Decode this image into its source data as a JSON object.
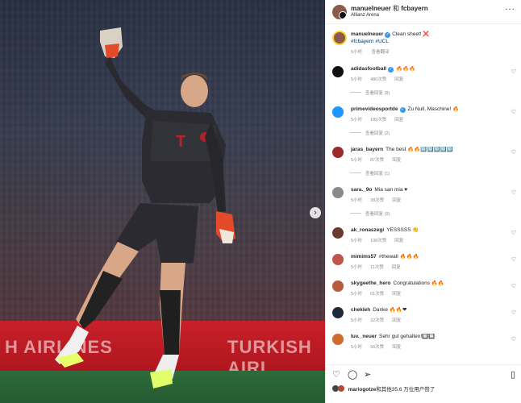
{
  "header": {
    "account": "manuelneuer",
    "joiner": "和",
    "collab": "fcbayern",
    "location": "Allianz Arena",
    "more": "···"
  },
  "caption": {
    "user": "manuelneuer",
    "text": "Clean sheet! ❌",
    "tags": "#fcbayern #UCL",
    "time": "5小时",
    "translate": "查看翻译"
  },
  "photo": {
    "ad_text_left": "H AIRLINES",
    "ad_text_right": "TURKISH AIRL",
    "next": "›"
  },
  "comments": [
    {
      "user": "adidasfootball",
      "verified": true,
      "text": "🔥🔥🔥",
      "time": "5小时",
      "likes": "480次赞",
      "reply": "回复",
      "replies": "查看回复 (8)",
      "avatar": "#111111"
    },
    {
      "user": "primevideosportde",
      "verified": true,
      "text": "Zu Null, Maschine! 🔥",
      "time": "5小时",
      "likes": "189次赞",
      "reply": "回复",
      "replies": "查看回复 (2)",
      "avatar": "#1a98ff"
    },
    {
      "user": "jaras_bayern",
      "verified": false,
      "text": "The best 🔥🔥🔟🔟🔟🔟🔟",
      "time": "5小时",
      "likes": "87次赞",
      "reply": "回复",
      "replies": "查看回复 (1)",
      "avatar": "#9c2a2a"
    },
    {
      "user": "sara._9o",
      "verified": false,
      "text": "Mia san mia ♥",
      "time": "5小时",
      "likes": "38次赞",
      "reply": "回复",
      "replies": "查看回复 (9)",
      "avatar": "#8a8a8a"
    },
    {
      "user": "ak_ronaszegi",
      "verified": false,
      "text": "YESSSSS 👏",
      "time": "5小时",
      "likes": "108次赞",
      "reply": "回复",
      "replies": "",
      "avatar": "#6b3a2e"
    },
    {
      "user": "mimims57",
      "verified": false,
      "text": "#thewall 🔥🔥🔥",
      "time": "5小时",
      "likes": "11次赞",
      "reply": "回复",
      "replies": "",
      "avatar": "#c0564a"
    },
    {
      "user": "skygeethe_hero",
      "verified": false,
      "text": "Congratulations 🔥🔥",
      "time": "5小时",
      "likes": "61次赞",
      "reply": "回复",
      "replies": "",
      "avatar": "#b85a3e"
    },
    {
      "user": "chekleh",
      "verified": false,
      "text": "Danke 🔥🔥❤",
      "time": "5小时",
      "likes": "32次赞",
      "reply": "回复",
      "replies": "",
      "avatar": "#1c2a3a"
    },
    {
      "user": "luv._neuer",
      "verified": false,
      "text": "Sehr gut gehalten!🔲🔲",
      "time": "5小时",
      "likes": "56次赞",
      "reply": "回复",
      "replies": "",
      "avatar": "#d06a2a"
    }
  ],
  "footer": {
    "liker": "mariogotze",
    "likes_text": "和其他35.6 万位用户赞了"
  },
  "colors": {
    "link": "#00376b",
    "verified": "#3897f0",
    "muted": "#8e8e8e",
    "ad_red": "#c8202a"
  },
  "icons": [
    "heart-icon",
    "comment-icon",
    "share-icon",
    "bookmark-icon",
    "more-icon",
    "verified-icon",
    "next-arrow-icon"
  ]
}
